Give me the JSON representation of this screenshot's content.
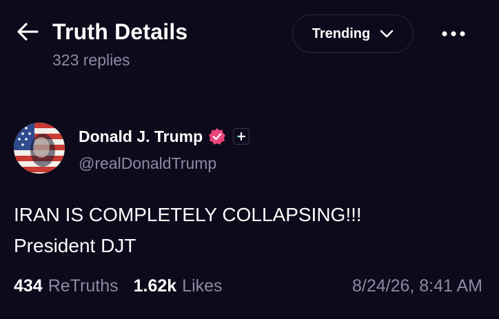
{
  "header": {
    "title": "Truth Details",
    "reply_count": "323 replies",
    "trending_label": "Trending"
  },
  "post": {
    "author_name": "Donald J. Trump",
    "author_handle": "@realDonaldTrump",
    "body_lines": [
      "IRAN IS COMPLETELY COLLAPSING!!!",
      "President DJT"
    ],
    "retruths_count": "434",
    "retruths_label": "ReTruths",
    "likes_count": "1.62k",
    "likes_label": "Likes",
    "timestamp": "8/24/26, 8:41 AM"
  },
  "colors": {
    "background": "#0c0a1b",
    "text_primary": "#ffffff",
    "text_secondary": "#8e8aa3",
    "verified_badge": "#e9457a",
    "button_border": "#2e2b42"
  },
  "icons": {
    "back": "arrow-left-icon",
    "trending_dropdown": "chevron-down-icon",
    "more": "more-horizontal-icon",
    "verified": "verified-badge-icon",
    "follow": "plus-icon"
  }
}
